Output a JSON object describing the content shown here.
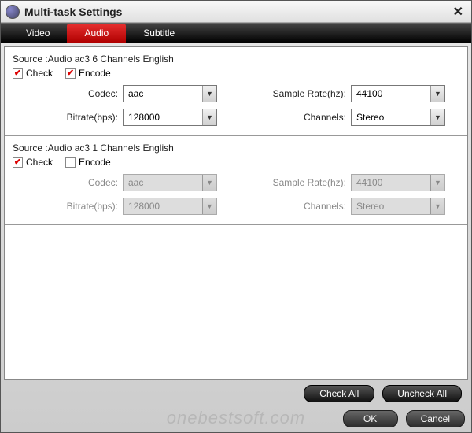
{
  "window": {
    "title": "Multi-task Settings",
    "close": "✕"
  },
  "tabs": {
    "video": "Video",
    "audio": "Audio",
    "subtitle": "Subtitle"
  },
  "labels": {
    "check": "Check",
    "encode": "Encode",
    "codec": "Codec:",
    "sample_rate": "Sample Rate(hz):",
    "bitrate": "Bitrate(bps):",
    "channels": "Channels:"
  },
  "tracks": [
    {
      "source": "Source :Audio  ac3  6 Channels  English",
      "check": true,
      "encode": true,
      "enabled": true,
      "codec": "aac",
      "sample_rate": "44100",
      "bitrate": "128000",
      "channels": "Stereo"
    },
    {
      "source": "Source :Audio  ac3  1 Channels  English",
      "check": true,
      "encode": false,
      "enabled": false,
      "codec": "aac",
      "sample_rate": "44100",
      "bitrate": "128000",
      "channels": "Stereo"
    }
  ],
  "buttons": {
    "check_all": "Check All",
    "uncheck_all": "Uncheck All",
    "ok": "OK",
    "cancel": "Cancel"
  },
  "watermark": "onebestsoft.com"
}
